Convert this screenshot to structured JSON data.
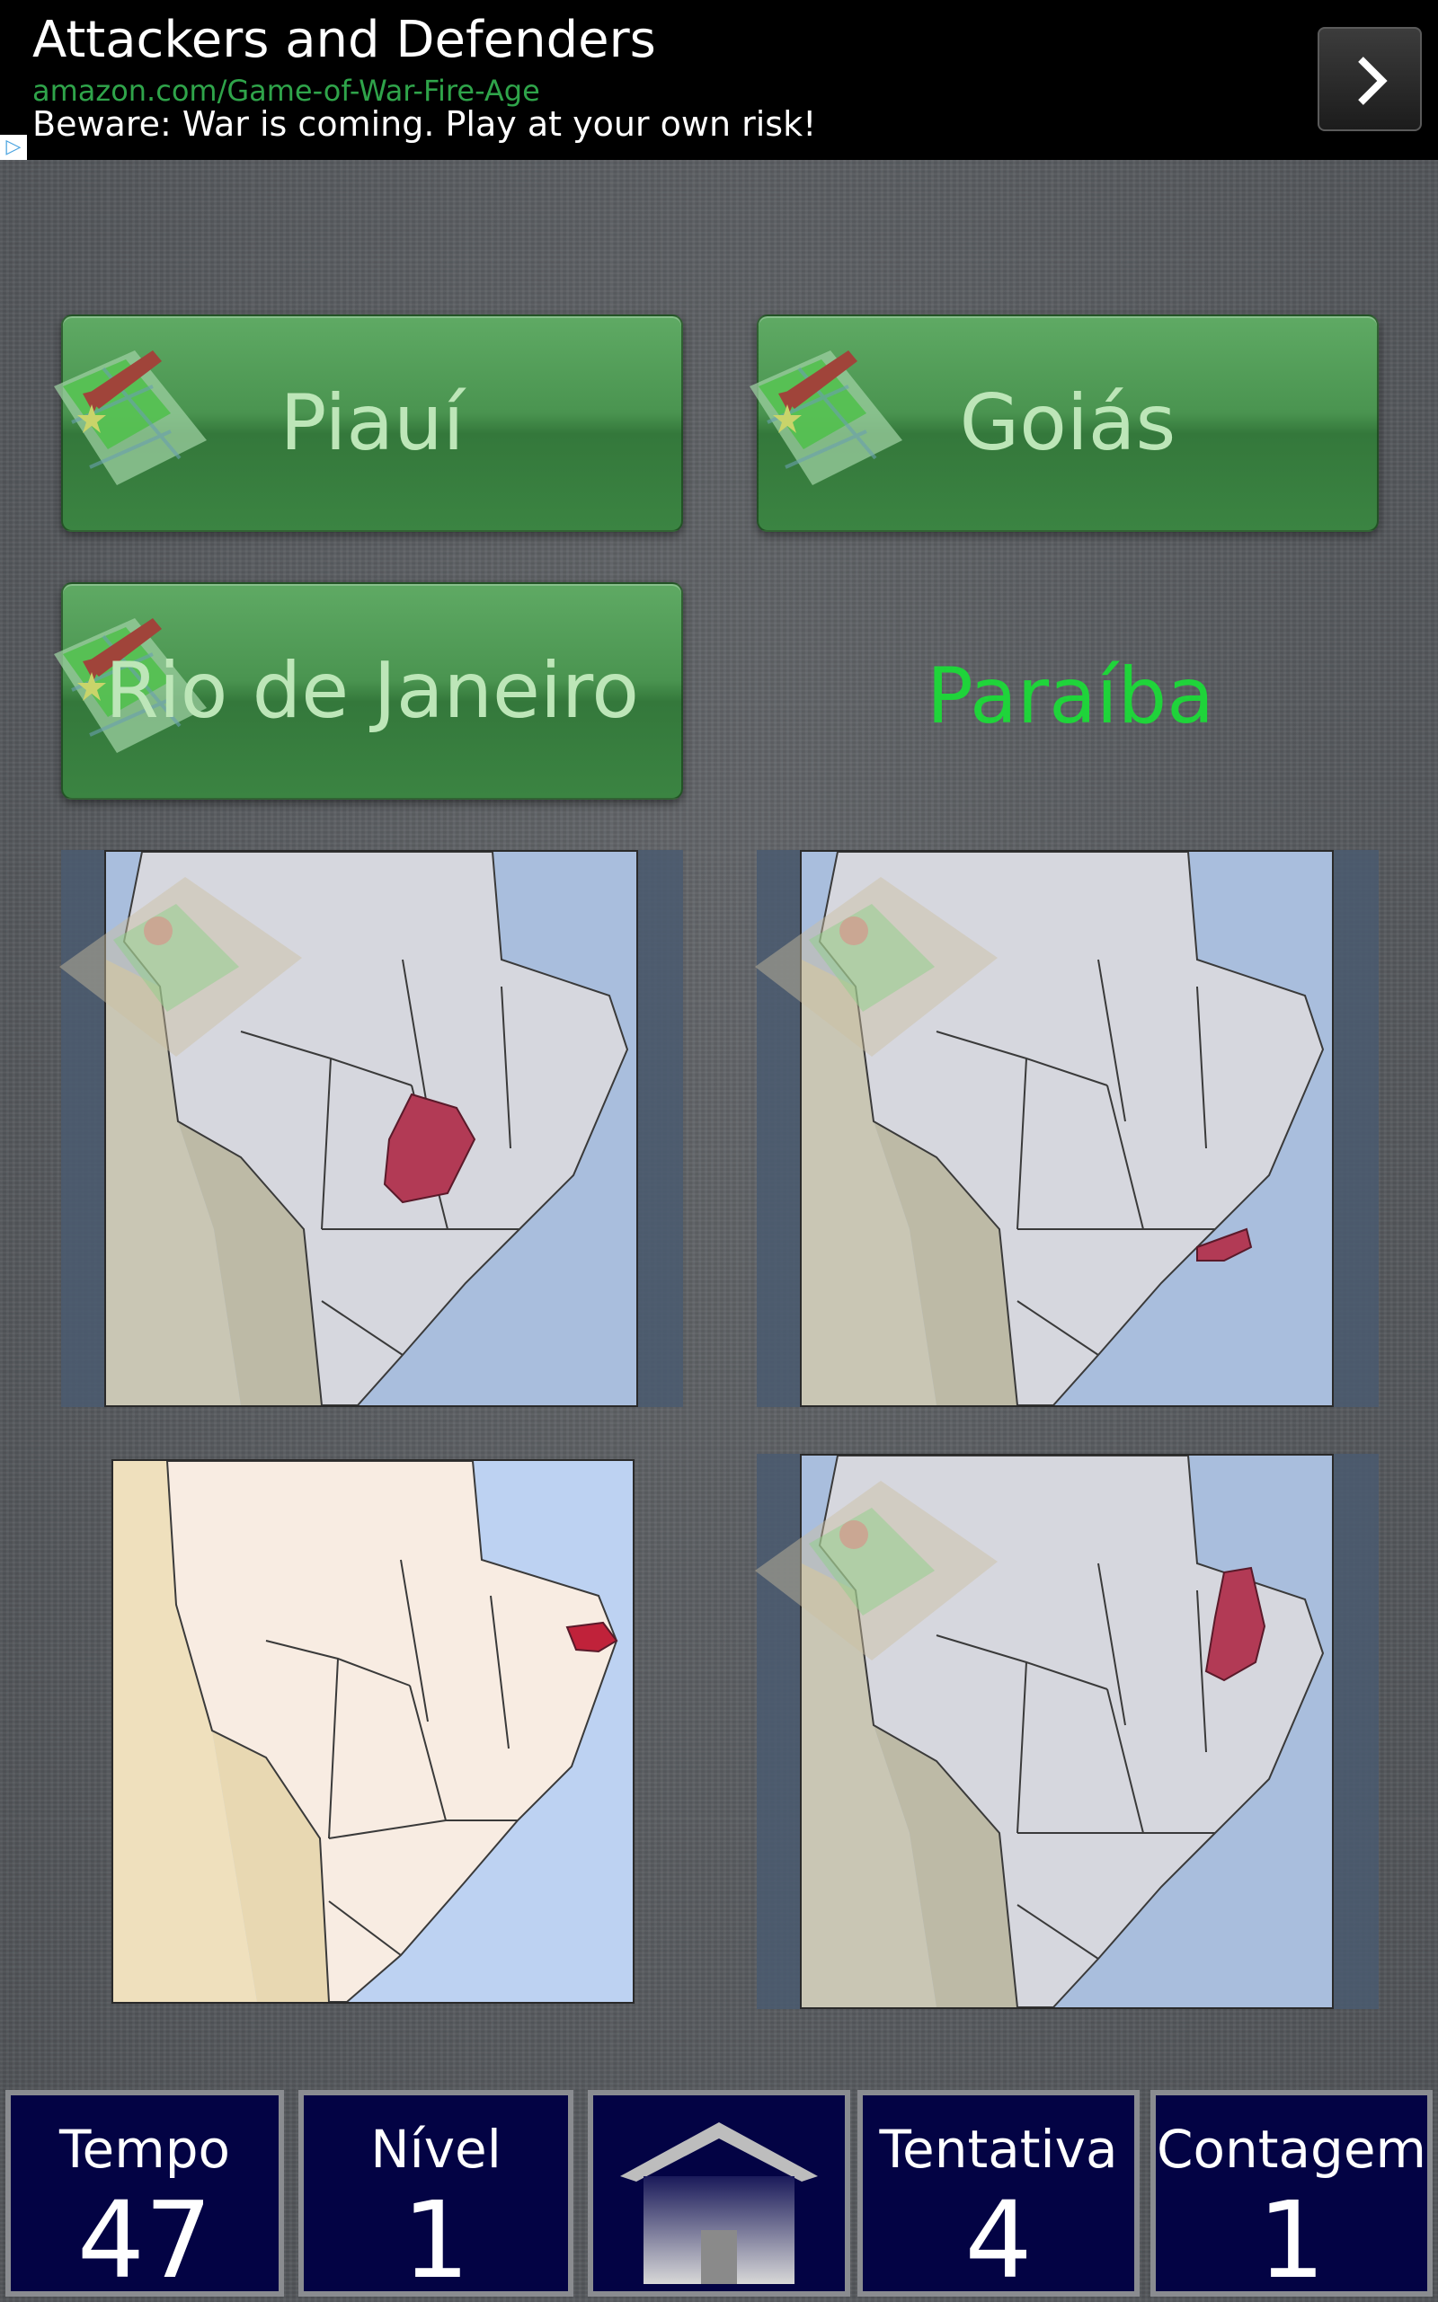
{
  "ad": {
    "title": "Attackers and Defenders",
    "url": "amazon.com/Game-of-War-Fire-Age",
    "description": "Beware: War is coming. Play at your own risk!",
    "info_icon": "info-triangle-icon",
    "next_icon": "chevron-right-icon"
  },
  "answers": [
    {
      "label": "Piauí"
    },
    {
      "label": "Goiás"
    },
    {
      "label": "Rio de Janeiro"
    }
  ],
  "target": {
    "label": "Paraíba"
  },
  "stats": {
    "time_label": "Tempo",
    "time_value": "47",
    "level_label": "Nível",
    "level_value": "1",
    "attempt_label": "Tentativa",
    "attempt_value": "4",
    "count_label": "Contagem",
    "count_value": "1"
  },
  "colors": {
    "highlight": "#b23a55",
    "answer_green": "#4a9450",
    "target_text": "#1fd43a",
    "stat_bg": "#030344"
  },
  "icons": {
    "home": "home-icon",
    "map_marker": "map-arrow-icon"
  }
}
